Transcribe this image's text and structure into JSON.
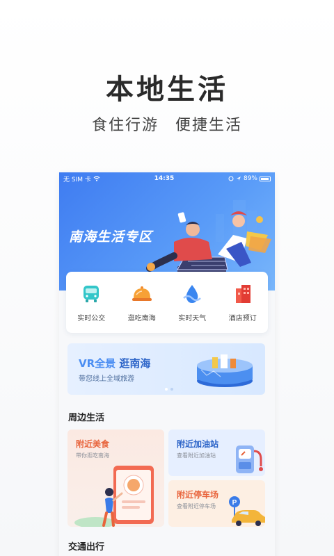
{
  "promo": {
    "title": "本地生活",
    "subtitle": "食住行游　便捷生活"
  },
  "status_bar": {
    "carrier": "无 SIM 卡",
    "time": "14:35",
    "battery": "89%"
  },
  "banner": {
    "title": "南海生活专区"
  },
  "quick_actions": [
    {
      "label": "实时公交",
      "icon": "bus-icon"
    },
    {
      "label": "逛吃南海",
      "icon": "dining-bell-icon"
    },
    {
      "label": "实时天气",
      "icon": "weather-drop-icon"
    },
    {
      "label": "酒店预订",
      "icon": "hotel-building-icon"
    }
  ],
  "vr_banner": {
    "title_accent": "VR全景",
    "title_main": " 逛南海",
    "subtitle": "带您线上全域旅游"
  },
  "nearby": {
    "section_title": "周边生活",
    "food": {
      "title": "附近美食",
      "subtitle": "带你逛吃南海"
    },
    "gas": {
      "title": "附近加油站",
      "subtitle": "查看附近加油站"
    },
    "parking": {
      "title": "附近停车场",
      "subtitle": "查看附近停车场"
    }
  },
  "transport": {
    "section_title": "交通出行"
  },
  "colors": {
    "brand_blue": "#3f7cf1",
    "food_title": "#e8643c",
    "gas_title": "#2c64c8",
    "parking_title": "#e8643c"
  }
}
